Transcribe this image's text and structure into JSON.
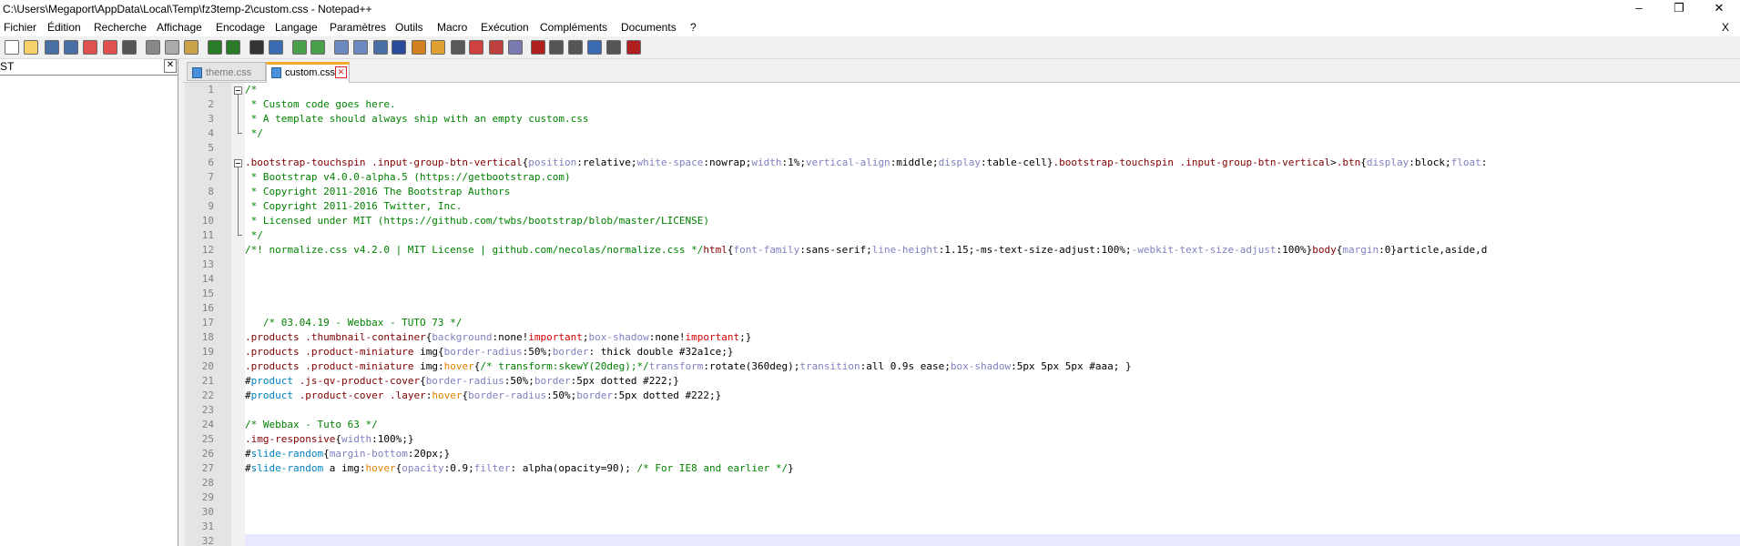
{
  "window": {
    "title": "C:\\Users\\Megaport\\AppData\\Local\\Temp\\fz3temp-2\\custom.css - Notepad++",
    "minimize": "–",
    "maximize": "❐",
    "close": "✕"
  },
  "menubar": {
    "items": [
      "Fichier",
      "Édition",
      "Recherche",
      "Affichage",
      "Encodage",
      "Langage",
      "Paramètres",
      "Outils",
      "Macro",
      "Exécution",
      "Compléments",
      "Documents",
      "?"
    ],
    "close": "X"
  },
  "toolbar": {
    "icons": [
      "new-file-icon",
      "open-file-icon",
      "save-icon",
      "save-all-icon",
      "close-icon",
      "close-all-icon",
      "print-icon",
      "cut-icon",
      "copy-icon",
      "paste-icon",
      "undo-icon",
      "redo-icon",
      "find-icon",
      "replace-icon",
      "zoom-in-icon",
      "zoom-out-icon",
      "sync-vertical-icon",
      "sync-horizontal-icon",
      "word-wrap-icon",
      "show-all-chars-icon",
      "indent-guide-icon",
      "user-lang-icon",
      "doc-map-icon",
      "function-list-icon",
      "folder-workspace-icon",
      "monitor-icon",
      "record-macro-icon",
      "stop-macro-icon",
      "play-macro-icon",
      "run-macro-multiple-icon",
      "save-macro-icon",
      "spell-check-icon"
    ]
  },
  "panel": {
    "title": "ST",
    "close": "✕"
  },
  "tabs": [
    {
      "label": "theme.css",
      "active": false
    },
    {
      "label": "custom.css",
      "active": true
    }
  ],
  "editor": {
    "line_numbers": [
      "1",
      "2",
      "3",
      "4",
      "5",
      "6",
      "7",
      "8",
      "9",
      "10",
      "11",
      "12",
      "13",
      "14",
      "15",
      "16",
      "17",
      "18",
      "19",
      "20",
      "21",
      "22",
      "23",
      "24",
      "25",
      "26",
      "27",
      "28",
      "29",
      "30",
      "31",
      "32"
    ],
    "lines": [
      [
        [
          "/*",
          "c"
        ]
      ],
      [
        [
          " * Custom code goes here.",
          "c"
        ]
      ],
      [
        [
          " * A template should always ship with an empty custom.css",
          "c"
        ]
      ],
      [
        [
          " */",
          "c"
        ]
      ],
      [],
      [
        [
          ".bootstrap-touchspin",
          "s"
        ],
        [
          " ",
          "t"
        ],
        [
          ".input-group-btn-vertical",
          "s"
        ],
        [
          "{",
          "t"
        ],
        [
          "position",
          "p"
        ],
        [
          ":relative;",
          "t"
        ],
        [
          "white-space",
          "p"
        ],
        [
          ":nowrap;",
          "t"
        ],
        [
          "width",
          "p"
        ],
        [
          ":1%;",
          "t"
        ],
        [
          "vertical-align",
          "p"
        ],
        [
          ":middle;",
          "t"
        ],
        [
          "display",
          "p"
        ],
        [
          ":table-cell}",
          "t"
        ],
        [
          ".bootstrap-touchspin",
          "s"
        ],
        [
          " ",
          "t"
        ],
        [
          ".input-group-btn-vertical",
          "s"
        ],
        [
          ">",
          "t"
        ],
        [
          ".btn",
          "s"
        ],
        [
          "{",
          "t"
        ],
        [
          "display",
          "p"
        ],
        [
          ":block;",
          "t"
        ],
        [
          "float",
          "p"
        ],
        [
          ":",
          "t"
        ]
      ],
      [
        [
          " * Bootstrap v4.0.0-alpha.5 (https://getbootstrap.com)",
          "c"
        ]
      ],
      [
        [
          " * Copyright 2011-2016 The Bootstrap Authors",
          "c"
        ]
      ],
      [
        [
          " * Copyright 2011-2016 Twitter, Inc.",
          "c"
        ]
      ],
      [
        [
          " * Licensed under MIT (https://github.com/twbs/bootstrap/blob/master/LICENSE)",
          "c"
        ]
      ],
      [
        [
          " */",
          "c"
        ]
      ],
      [
        [
          "/*! normalize.css v4.2.0 | MIT License | github.com/necolas/normalize.css */",
          "c"
        ],
        [
          "html",
          "s"
        ],
        [
          "{",
          "t"
        ],
        [
          "font-family",
          "p"
        ],
        [
          ":sans-serif;",
          "t"
        ],
        [
          "line-height",
          "p"
        ],
        [
          ":1.15;-ms-text-size-adjust:100%;",
          "t"
        ],
        [
          "-webkit-text-size-adjust",
          "p"
        ],
        [
          ":100%}",
          "t"
        ],
        [
          "body",
          "s"
        ],
        [
          "{",
          "t"
        ],
        [
          "margin",
          "p"
        ],
        [
          ":0}",
          "t"
        ],
        [
          "article,aside,d",
          "t"
        ]
      ],
      [],
      [],
      [],
      [],
      [
        [
          "   /* 03.04.19 - Webbax - TUTO 73 */",
          "c"
        ]
      ],
      [
        [
          ".products",
          "s"
        ],
        [
          " ",
          "t"
        ],
        [
          ".thumbnail-container",
          "s"
        ],
        [
          "{",
          "t"
        ],
        [
          "background",
          "p"
        ],
        [
          ":none!",
          "t"
        ],
        [
          "important",
          "i"
        ],
        [
          ";",
          "t"
        ],
        [
          "box-shadow",
          "p"
        ],
        [
          ":none!",
          "t"
        ],
        [
          "important",
          "i"
        ],
        [
          ";}",
          "t"
        ]
      ],
      [
        [
          ".products",
          "s"
        ],
        [
          " ",
          "t"
        ],
        [
          ".product-miniature",
          "s"
        ],
        [
          " img{",
          "t"
        ],
        [
          "border-radius",
          "p"
        ],
        [
          ":50%;",
          "t"
        ],
        [
          "border",
          "p"
        ],
        [
          ": thick double #32a1ce;}",
          "t"
        ]
      ],
      [
        [
          ".products",
          "s"
        ],
        [
          " ",
          "t"
        ],
        [
          ".product-miniature",
          "s"
        ],
        [
          " img:",
          "t"
        ],
        [
          "hover",
          "h"
        ],
        [
          "{",
          "t"
        ],
        [
          "/* transform:skewY(20deg);*/",
          "c"
        ],
        [
          "transform",
          "p"
        ],
        [
          ":rotate(360deg);",
          "t"
        ],
        [
          "transition",
          "p"
        ],
        [
          ":all 0.9s ease;",
          "t"
        ],
        [
          "box-shadow",
          "p"
        ],
        [
          ":5px 5px 5px #aaa; }",
          "t"
        ]
      ],
      [
        [
          "#",
          "t"
        ],
        [
          "product",
          "d"
        ],
        [
          " ",
          "t"
        ],
        [
          ".js-qv-product-cover",
          "s"
        ],
        [
          "{",
          "t"
        ],
        [
          "border-radius",
          "p"
        ],
        [
          ":50%;",
          "t"
        ],
        [
          "border",
          "p"
        ],
        [
          ":5px dotted #222;}",
          "t"
        ]
      ],
      [
        [
          "#",
          "t"
        ],
        [
          "product",
          "d"
        ],
        [
          " ",
          "t"
        ],
        [
          ".product-cover",
          "s"
        ],
        [
          " ",
          "t"
        ],
        [
          ".layer",
          "s"
        ],
        [
          ":",
          "t"
        ],
        [
          "hover",
          "h"
        ],
        [
          "{",
          "t"
        ],
        [
          "border-radius",
          "p"
        ],
        [
          ":50%;",
          "t"
        ],
        [
          "border",
          "p"
        ],
        [
          ":5px dotted #222;}",
          "t"
        ]
      ],
      [],
      [
        [
          "/* Webbax - Tuto 63 */",
          "c"
        ]
      ],
      [
        [
          ".img-responsive",
          "s"
        ],
        [
          "{",
          "t"
        ],
        [
          "width",
          "p"
        ],
        [
          ":100%;}",
          "t"
        ]
      ],
      [
        [
          "#",
          "t"
        ],
        [
          "slide-random",
          "d"
        ],
        [
          "{",
          "t"
        ],
        [
          "margin-bottom",
          "p"
        ],
        [
          ":20px;}",
          "t"
        ]
      ],
      [
        [
          "#",
          "t"
        ],
        [
          "slide-random",
          "d"
        ],
        [
          " a img:",
          "t"
        ],
        [
          "hover",
          "h"
        ],
        [
          "{",
          "t"
        ],
        [
          "opacity",
          "p"
        ],
        [
          ":0.9;",
          "t"
        ],
        [
          "filter",
          "p"
        ],
        [
          ": alpha(opacity=90); ",
          "t"
        ],
        [
          "/* For IE8 and earlier */",
          "c"
        ],
        [
          "}",
          "t"
        ]
      ],
      [],
      [],
      [],
      [],
      []
    ],
    "colors": {
      "comment": "#008000",
      "selector": "#800000",
      "property": "#8080c0",
      "value": "#000000",
      "important": "#d40000",
      "hover": "#e08000",
      "id": "#0080c0"
    }
  }
}
